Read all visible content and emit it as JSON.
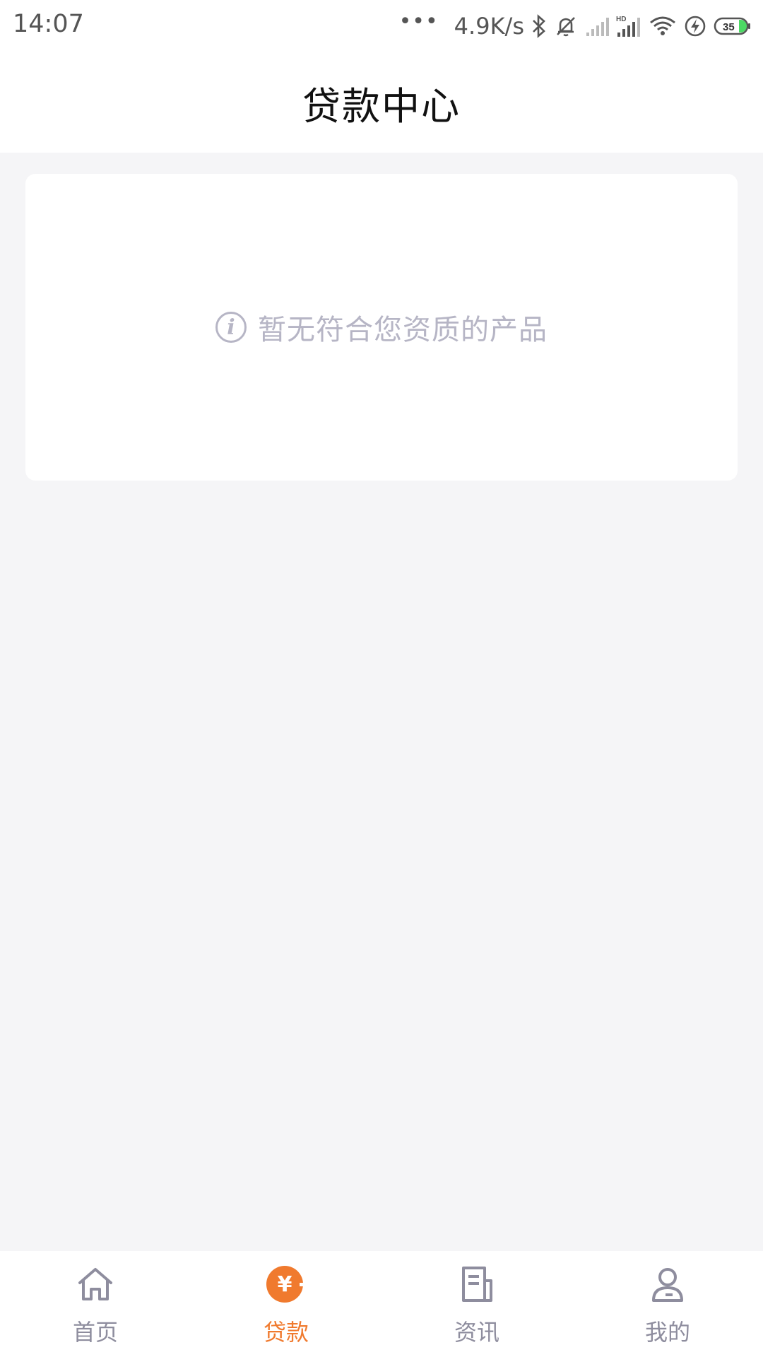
{
  "status_bar": {
    "time": "14:07",
    "dots": "•••",
    "speed": "4.9K/s",
    "battery": "35",
    "icons": [
      "bluetooth-icon",
      "mute-icon",
      "signal-icon",
      "hd-signal-icon",
      "wifi-icon",
      "charging-icon",
      "battery-icon"
    ]
  },
  "header": {
    "title": "贷款中心"
  },
  "main": {
    "empty_icon": "i",
    "empty_message": "暂无符合您资质的产品"
  },
  "nav": {
    "items": [
      {
        "label": "首页",
        "icon": "home-icon",
        "active": false
      },
      {
        "label": "贷款",
        "icon": "loan-yen-icon",
        "active": true
      },
      {
        "label": "资讯",
        "icon": "news-icon",
        "active": false
      },
      {
        "label": "我的",
        "icon": "profile-icon",
        "active": false
      }
    ],
    "yen_symbol": "¥"
  },
  "colors": {
    "accent": "#f07a2e",
    "inactive": "#8e8d9e",
    "background": "#f5f5f7",
    "empty_text": "#b6b5c5"
  }
}
